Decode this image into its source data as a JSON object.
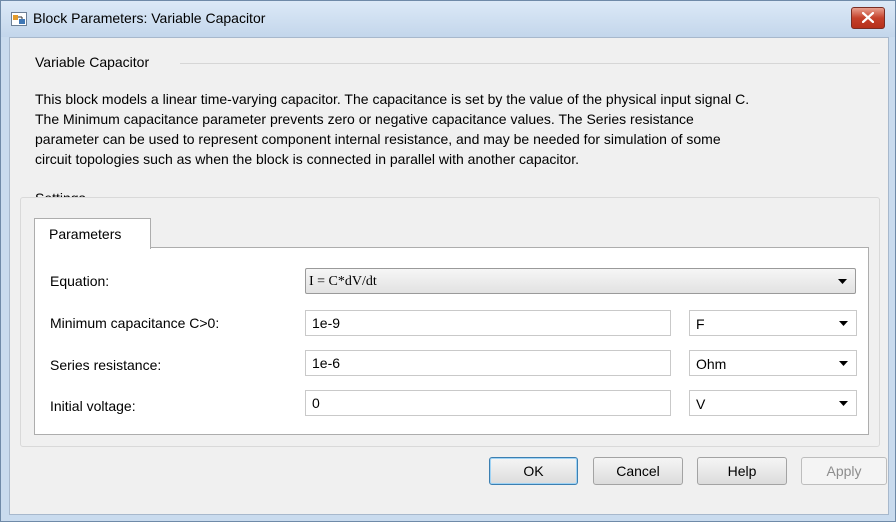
{
  "window": {
    "title": "Block Parameters: Variable Capacitor"
  },
  "header": {
    "group_label": "Variable Capacitor",
    "description": [
      "This block models a linear time-varying capacitor. The capacitance is set by the value of the physical input signal C.",
      "The Minimum capacitance parameter prevents zero or negative capacitance values. The Series resistance",
      "parameter can be used to represent component internal resistance, and may be needed for simulation of some",
      "circuit topologies such as when the block is connected in parallel with another capacitor."
    ]
  },
  "settings": {
    "group_label": "Settings",
    "tab_label": "Parameters",
    "params": {
      "equation": {
        "label": "Equation:",
        "value": "I = C*dV/dt"
      },
      "min_cap": {
        "label": "Minimum capacitance C>0:",
        "value": "1e-9",
        "unit": "F"
      },
      "series_res": {
        "label": "Series resistance:",
        "value": "1e-6",
        "unit": "Ohm"
      },
      "init_voltage": {
        "label": "Initial voltage:",
        "value": "0",
        "unit": "V"
      }
    }
  },
  "buttons": {
    "ok": "OK",
    "cancel": "Cancel",
    "help": "Help",
    "apply": "Apply"
  },
  "colors": {
    "close_button": "#c5412b",
    "default_button_border": "#3c7fb1"
  },
  "icons": {
    "app": "simulink-block-icon",
    "close": "close-icon",
    "dropdown": "chevron-down-icon"
  }
}
